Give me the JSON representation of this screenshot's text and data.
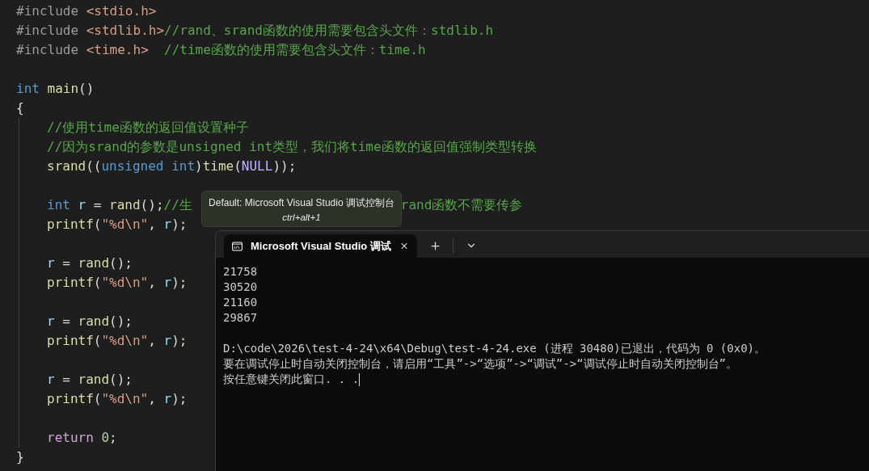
{
  "editor": {
    "lines": [
      {
        "kind": "code",
        "indented": false,
        "tokens": [
          {
            "kind": "pre",
            "text": "#include"
          },
          {
            "kind": "header",
            "text": " <stdio.h>"
          }
        ]
      },
      {
        "kind": "code",
        "indented": false,
        "tokens": [
          {
            "kind": "pre",
            "text": "#include"
          },
          {
            "kind": "header",
            "text": " <stdlib.h>"
          },
          {
            "kind": "comment",
            "text": "//rand、srand函数的使用需要包含头文件：stdlib.h"
          }
        ]
      },
      {
        "kind": "code",
        "indented": false,
        "tokens": [
          {
            "kind": "pre",
            "text": "#include"
          },
          {
            "kind": "header",
            "text": " <time.h>"
          },
          {
            "kind": "comment",
            "text": "  //time函数的使用需要包含头文件：time.h"
          }
        ]
      },
      {
        "kind": "blank"
      },
      {
        "kind": "code",
        "indented": false,
        "tokens": [
          {
            "kind": "keyword",
            "text": "int"
          },
          {
            "kind": "function",
            "text": " main"
          },
          {
            "kind": "plain",
            "text": "()"
          }
        ]
      },
      {
        "kind": "code",
        "indented": false,
        "tokens": [
          {
            "kind": "brace",
            "text": "{"
          }
        ]
      },
      {
        "kind": "code",
        "indented": true,
        "tokens": [
          {
            "kind": "comment",
            "text": "//使用time函数的返回值设置种子"
          }
        ]
      },
      {
        "kind": "code",
        "indented": true,
        "tokens": [
          {
            "kind": "comment",
            "text": "//因为srand的参数是unsigned int类型，我们将time函数的返回值强制类型转换"
          }
        ]
      },
      {
        "kind": "code",
        "indented": true,
        "tokens": [
          {
            "kind": "function",
            "text": "srand"
          },
          {
            "kind": "plain",
            "text": "(("
          },
          {
            "kind": "keyword",
            "text": "unsigned int"
          },
          {
            "kind": "plain",
            "text": ")"
          },
          {
            "kind": "function",
            "text": "time"
          },
          {
            "kind": "plain",
            "text": "("
          },
          {
            "kind": "macro",
            "text": "NULL"
          },
          {
            "kind": "plain",
            "text": "));"
          }
        ]
      },
      {
        "kind": "blank"
      },
      {
        "kind": "code",
        "indented": true,
        "tokens": [
          {
            "kind": "keyword",
            "text": "int"
          },
          {
            "kind": "variable",
            "text": " r"
          },
          {
            "kind": "plain",
            "text": " = "
          },
          {
            "kind": "function",
            "text": "rand"
          },
          {
            "kind": "plain",
            "text": "();"
          },
          {
            "kind": "comment",
            "text": "//生"
          },
          {
            "kind": "comment-after-tooltip",
            "text": "rand函数不需要传参"
          }
        ]
      },
      {
        "kind": "code",
        "indented": true,
        "tokens": [
          {
            "kind": "function",
            "text": "printf"
          },
          {
            "kind": "plain",
            "text": "("
          },
          {
            "kind": "string",
            "text": "\"%d\\n\""
          },
          {
            "kind": "plain",
            "text": ", "
          },
          {
            "kind": "variable",
            "text": "r"
          },
          {
            "kind": "plain",
            "text": ");"
          }
        ]
      },
      {
        "kind": "blank"
      },
      {
        "kind": "code",
        "indented": true,
        "tokens": [
          {
            "kind": "variable",
            "text": "r"
          },
          {
            "kind": "plain",
            "text": " = "
          },
          {
            "kind": "function",
            "text": "rand"
          },
          {
            "kind": "plain",
            "text": "();"
          }
        ]
      },
      {
        "kind": "code",
        "indented": true,
        "tokens": [
          {
            "kind": "function",
            "text": "printf"
          },
          {
            "kind": "plain",
            "text": "("
          },
          {
            "kind": "string",
            "text": "\"%d\\n\""
          },
          {
            "kind": "plain",
            "text": ", "
          },
          {
            "kind": "variable",
            "text": "r"
          },
          {
            "kind": "plain",
            "text": ");"
          }
        ]
      },
      {
        "kind": "blank"
      },
      {
        "kind": "code",
        "indented": true,
        "tokens": [
          {
            "kind": "variable",
            "text": "r"
          },
          {
            "kind": "plain",
            "text": " = "
          },
          {
            "kind": "function",
            "text": "rand"
          },
          {
            "kind": "plain",
            "text": "();"
          }
        ]
      },
      {
        "kind": "code",
        "indented": true,
        "tokens": [
          {
            "kind": "function",
            "text": "printf"
          },
          {
            "kind": "plain",
            "text": "("
          },
          {
            "kind": "string",
            "text": "\"%d\\n\""
          },
          {
            "kind": "plain",
            "text": ", "
          },
          {
            "kind": "variable",
            "text": "r"
          },
          {
            "kind": "plain",
            "text": ");"
          }
        ]
      },
      {
        "kind": "blank"
      },
      {
        "kind": "code",
        "indented": true,
        "tokens": [
          {
            "kind": "variable",
            "text": "r"
          },
          {
            "kind": "plain",
            "text": " = "
          },
          {
            "kind": "function",
            "text": "rand"
          },
          {
            "kind": "plain",
            "text": "();"
          }
        ]
      },
      {
        "kind": "code",
        "indented": true,
        "tokens": [
          {
            "kind": "function",
            "text": "printf"
          },
          {
            "kind": "plain",
            "text": "("
          },
          {
            "kind": "string",
            "text": "\"%d\\n\""
          },
          {
            "kind": "plain",
            "text": ", "
          },
          {
            "kind": "variable",
            "text": "r"
          },
          {
            "kind": "plain",
            "text": ");"
          }
        ]
      },
      {
        "kind": "blank"
      },
      {
        "kind": "code",
        "indented": true,
        "tokens": [
          {
            "kind": "control",
            "text": "return"
          },
          {
            "kind": "number",
            "text": " 0"
          },
          {
            "kind": "plain",
            "text": ";"
          }
        ]
      },
      {
        "kind": "code",
        "indented": false,
        "tokens": [
          {
            "kind": "brace",
            "text": "}"
          }
        ]
      }
    ]
  },
  "tooltip": {
    "title": "Default: Microsoft Visual Studio 调试控制台",
    "shortcut": "ctrl+alt+1"
  },
  "terminal": {
    "tab": {
      "title": "Microsoft Visual Studio 调试",
      "selected": true
    },
    "output": [
      {
        "kind": "text",
        "text": "21758"
      },
      {
        "kind": "text",
        "text": "30520"
      },
      {
        "kind": "text",
        "text": "21160"
      },
      {
        "kind": "text",
        "text": "29867"
      },
      {
        "kind": "blank"
      },
      {
        "kind": "text",
        "text": "D:\\code\\2026\\test-4-24\\x64\\Debug\\test-4-24.exe (进程 30480)已退出，代码为 0 (0x0)。"
      },
      {
        "kind": "text",
        "text": "要在调试停止时自动关闭控制台，请启用“工具”->“选项”->“调试”->“调试停止时自动关闭控制台”。"
      },
      {
        "kind": "text",
        "text": "按任意键关闭此窗口. . ."
      }
    ]
  }
}
